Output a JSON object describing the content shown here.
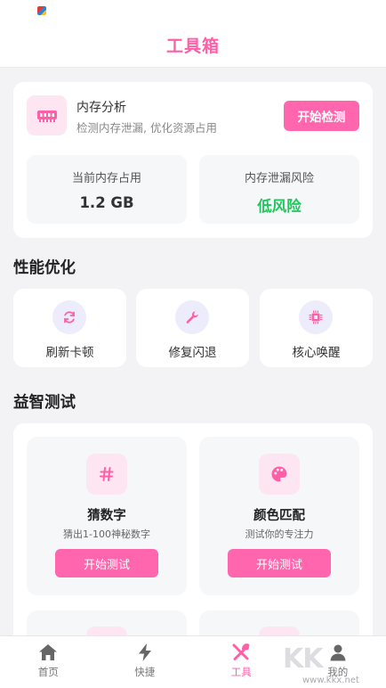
{
  "appbar": {
    "title": "工具箱"
  },
  "memory": {
    "title": "内存分析",
    "desc": "检测内存泄漏, 优化资源占用",
    "button": "开始检测",
    "stats": [
      {
        "label": "当前内存占用",
        "value": "1.2 GB"
      },
      {
        "label": "内存泄漏风险",
        "value": "低风险"
      }
    ],
    "risk_color": "#22c55e"
  },
  "performance": {
    "title": "性能优化",
    "items": [
      {
        "label": "刷新卡顿",
        "icon": "refresh-icon"
      },
      {
        "label": "修复闪退",
        "icon": "wrench-icon"
      },
      {
        "label": "核心唤醒",
        "icon": "chip-icon"
      }
    ]
  },
  "quiz": {
    "title": "益智测试",
    "items": [
      {
        "name": "猜数字",
        "desc": "猜出1-100神秘数字",
        "button": "开始测试",
        "icon": "hash-icon"
      },
      {
        "name": "颜色匹配",
        "desc": "测试你的专注力",
        "button": "开始测试",
        "icon": "palette-icon"
      }
    ]
  },
  "nav": {
    "items": [
      {
        "label": "首页",
        "icon": "home-icon"
      },
      {
        "label": "快捷",
        "icon": "bolt-icon"
      },
      {
        "label": "工具",
        "icon": "tools-icon",
        "active": true
      },
      {
        "label": "我的",
        "icon": "user-icon"
      }
    ]
  },
  "watermark": {
    "brand": "KK",
    "url": "www.kkx.net"
  },
  "colors": {
    "accent": "#ff5fa6",
    "button": "#ff66ad",
    "icon_bg": "#fde6f1"
  }
}
